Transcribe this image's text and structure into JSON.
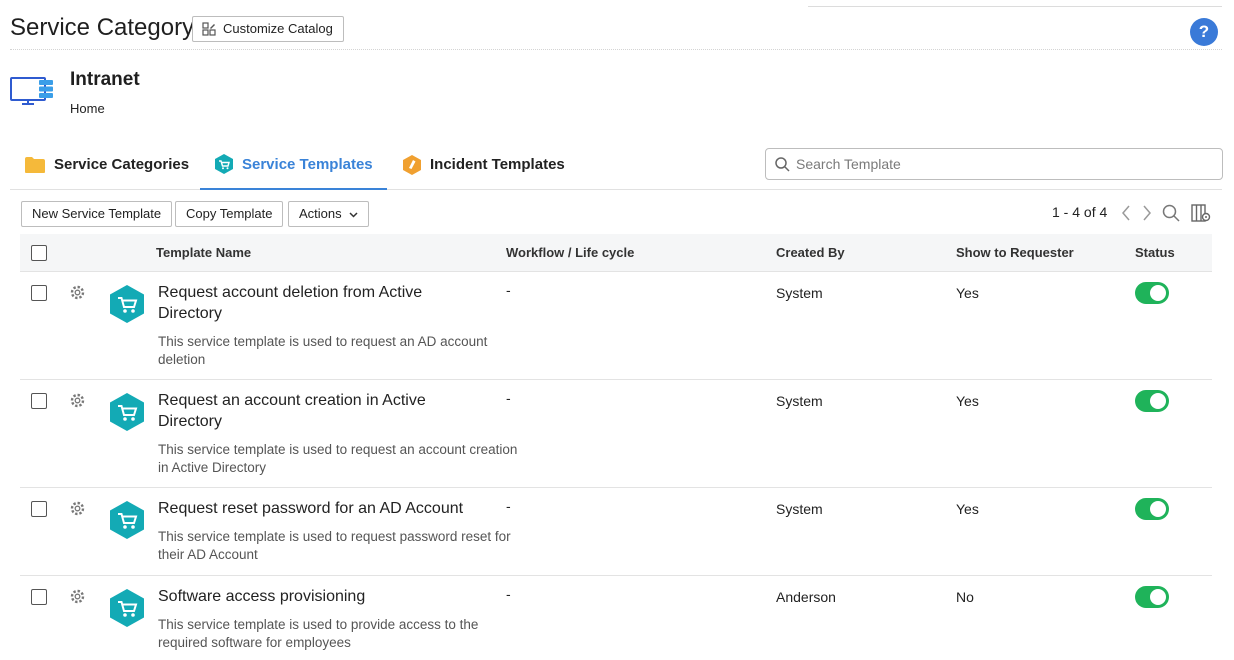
{
  "header": {
    "title": "Service Category",
    "customize_label": "Customize Catalog",
    "help_label": "?"
  },
  "category": {
    "name": "Intranet",
    "breadcrumb": "Home"
  },
  "tabs": [
    {
      "label": "Service Categories",
      "icon": "folder-icon",
      "active": false
    },
    {
      "label": "Service Templates",
      "icon": "service-template-icon",
      "active": true
    },
    {
      "label": "Incident Templates",
      "icon": "incident-template-icon",
      "active": false
    }
  ],
  "search": {
    "placeholder": "Search Template"
  },
  "toolbar": {
    "new_label": "New Service Template",
    "copy_label": "Copy Template",
    "actions_label": "Actions"
  },
  "pager": {
    "text": "1 - 4 of 4"
  },
  "columns": {
    "name": "Template Name",
    "workflow": "Workflow / Life cycle",
    "created_by": "Created By",
    "show": "Show to Requester",
    "status": "Status"
  },
  "rows": [
    {
      "name": "Request account deletion from Active Directory",
      "desc": "This service template is used to request an AD account deletion",
      "workflow": "-",
      "created_by": "System",
      "show": "Yes",
      "status_on": true
    },
    {
      "name": "Request an account creation in Active Directory",
      "desc": "This service template is used to request an account creation in Active Directory",
      "workflow": "-",
      "created_by": "System",
      "show": "Yes",
      "status_on": true
    },
    {
      "name": "Request reset password for an AD Account",
      "desc": "This service template is used to request password reset for their AD Account",
      "workflow": "-",
      "created_by": "System",
      "show": "Yes",
      "status_on": true
    },
    {
      "name": "Software access provisioning",
      "desc": "This service template is used to provide access to the required software for employees",
      "workflow": "-",
      "created_by": "Anderson",
      "show": "No",
      "status_on": true
    }
  ],
  "colors": {
    "accent": "#3a83d8",
    "toggle_on": "#1fb35a",
    "template_icon": "#13aab5",
    "folder": "#f5b93a",
    "incident": "#f0a030"
  }
}
